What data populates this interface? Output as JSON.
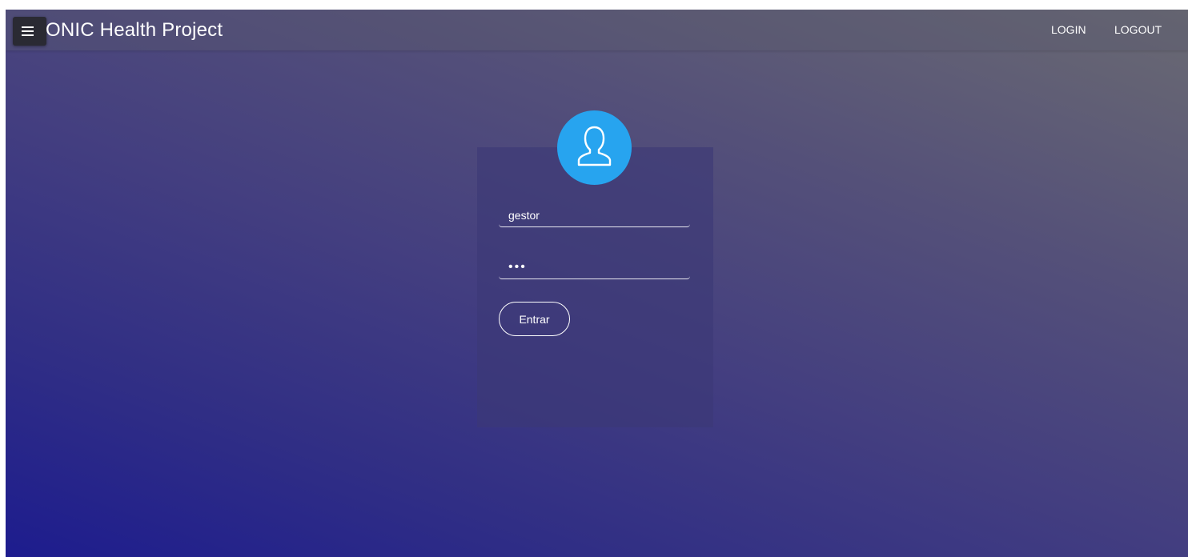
{
  "header": {
    "title": "ONIC Health Project",
    "nav": {
      "login_label": "LOGIN",
      "logout_label": "LOGOUT"
    },
    "menu_icon": "hamburger-menu-icon"
  },
  "login_form": {
    "avatar_icon": "user-icon",
    "username": {
      "value": "gestor"
    },
    "password": {
      "value": "•••"
    },
    "submit_label": "Entrar"
  },
  "colors": {
    "avatar_background": "#27a4ef",
    "gradient_start": "#1d1c8e",
    "gradient_end": "#6a6a72"
  }
}
